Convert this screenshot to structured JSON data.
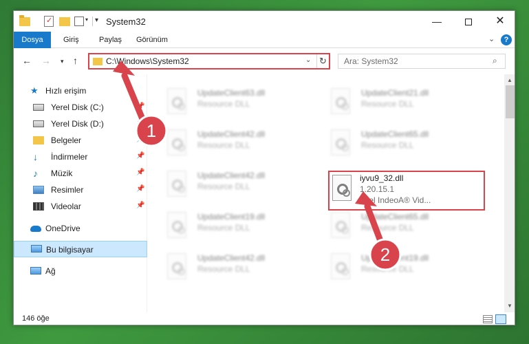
{
  "window": {
    "title": "System32",
    "controls": {
      "minimize": "—",
      "close": "✕"
    }
  },
  "ribbon": {
    "file_tab": "Dosya",
    "tabs": [
      "Giriş",
      "Paylaş",
      "Görünüm"
    ],
    "help": "?"
  },
  "address_bar": {
    "path": "C:\\Windows\\System32",
    "search_placeholder": "Ara: System32"
  },
  "nav_pane": {
    "items": [
      {
        "label": "Hızlı erişim",
        "icon": "star-icon",
        "pinned": false
      },
      {
        "label": "Yerel Disk (C:)",
        "icon": "drive-icon",
        "pinned": true
      },
      {
        "label": "Yerel Disk (D:)",
        "icon": "drive-icon",
        "pinned": true
      },
      {
        "label": "Belgeler",
        "icon": "folder-icon",
        "pinned": true
      },
      {
        "label": "İndirmeler",
        "icon": "download-icon",
        "pinned": true
      },
      {
        "label": "Müzik",
        "icon": "music-icon",
        "pinned": true
      },
      {
        "label": "Resimler",
        "icon": "pictures-icon",
        "pinned": true
      },
      {
        "label": "Videolar",
        "icon": "video-icon",
        "pinned": true
      },
      {
        "label": "OneDrive",
        "icon": "cloud-icon",
        "pinned": false
      },
      {
        "label": "Bu bilgisayar",
        "icon": "computer-icon",
        "pinned": false,
        "selected": true
      },
      {
        "label": "Ağ",
        "icon": "network-icon",
        "pinned": false
      }
    ]
  },
  "files": [
    {
      "name": "UpdateClient63.dll",
      "type": "Resource DLL"
    },
    {
      "name": "UpdateClient21.dll",
      "type": "Resource DLL"
    },
    {
      "name": "UpdateClient42.dll",
      "type": "Resource DLL"
    },
    {
      "name": "UpdateClient65.dll",
      "type": "Resource DLL"
    },
    {
      "name": "UpdateClient42.dll",
      "type": "Resource DLL"
    },
    {
      "name": "UpdateClient19.dll",
      "type": "Resource DLL"
    },
    {
      "name": "UpdateClient65.dll",
      "type": "Resource DLL"
    },
    {
      "name": "UpdateClient42.dll",
      "type": "Resource DLL"
    },
    {
      "name": "UpdateClient19.dll",
      "type": "Resource DLL"
    }
  ],
  "highlighted_file": {
    "name": "iyvu9_32.dll",
    "version": "1.20.15.1",
    "description": "Intel IndeoA® Vid..."
  },
  "status": {
    "item_count": "146 öğe"
  },
  "annotations": {
    "marker_1": "1",
    "marker_2": "2",
    "color": "#d9434b"
  }
}
